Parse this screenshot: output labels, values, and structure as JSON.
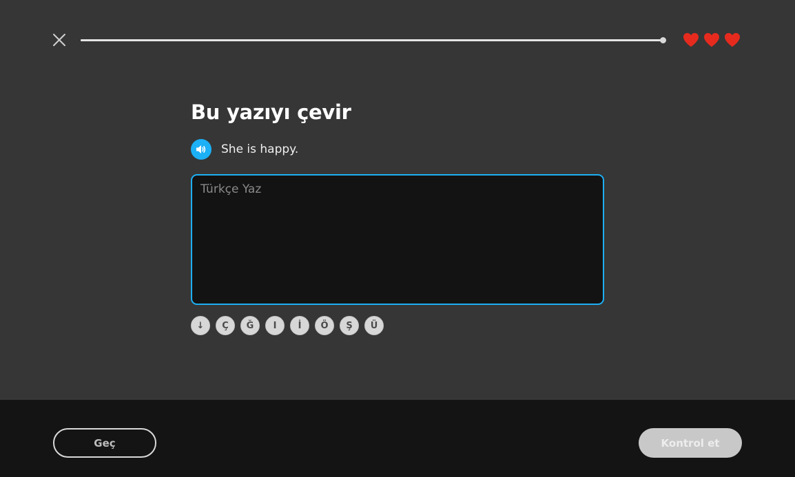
{
  "header": {
    "close_icon": "close-icon",
    "progress_fraction": 1.0,
    "hearts": {
      "count": 3,
      "color": "#e62b1e",
      "icon": "heart-icon"
    }
  },
  "challenge": {
    "title": "Bu yazıyı çevir",
    "speaker_icon": "speaker-icon",
    "prompt": "She is happy.",
    "answer_placeholder": "Türkçe Yaz",
    "answer_value": ""
  },
  "special_chars": [
    "↓",
    "Ç",
    "Ğ",
    "I",
    "İ",
    "Ö",
    "Ş",
    "Ü"
  ],
  "footer": {
    "skip_label": "Geç",
    "check_label": "Kontrol et"
  },
  "colors": {
    "accent": "#1cb0f6",
    "heart": "#e62b1e",
    "background": "#363636",
    "footer": "#141414"
  }
}
